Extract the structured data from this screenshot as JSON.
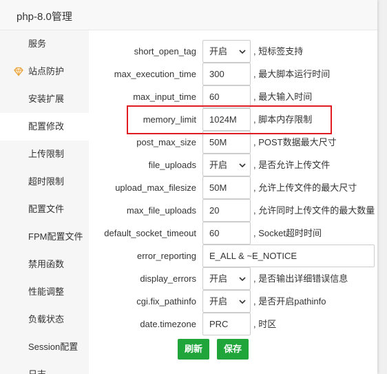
{
  "window": {
    "title": "php-8.0管理"
  },
  "sidebar": {
    "items": [
      {
        "label": "服务"
      },
      {
        "label": "站点防护"
      },
      {
        "label": "安装扩展"
      },
      {
        "label": "配置修改"
      },
      {
        "label": "上传限制"
      },
      {
        "label": "超时限制"
      },
      {
        "label": "配置文件"
      },
      {
        "label": "FPM配置文件"
      },
      {
        "label": "禁用函数"
      },
      {
        "label": "性能调整"
      },
      {
        "label": "负载状态"
      },
      {
        "label": "Session配置"
      },
      {
        "label": "日志"
      }
    ],
    "active": "配置修改"
  },
  "config": {
    "rows": [
      {
        "key": "short_open_tag",
        "value": "开启",
        "type": "select",
        "desc": ", 短标签支持"
      },
      {
        "key": "max_execution_time",
        "value": "300",
        "type": "input",
        "desc": ", 最大脚本运行时间"
      },
      {
        "key": "max_input_time",
        "value": "60",
        "type": "input",
        "desc": ", 最大输入时间"
      },
      {
        "key": "memory_limit",
        "value": "1024M",
        "type": "input",
        "desc": ", 脚本内存限制"
      },
      {
        "key": "post_max_size",
        "value": "50M",
        "type": "input",
        "desc": ", POST数据最大尺寸"
      },
      {
        "key": "file_uploads",
        "value": "开启",
        "type": "select",
        "desc": ", 是否允许上传文件"
      },
      {
        "key": "upload_max_filesize",
        "value": "50M",
        "type": "input",
        "desc": ", 允许上传文件的最大尺寸"
      },
      {
        "key": "max_file_uploads",
        "value": "20",
        "type": "input",
        "desc": ", 允许同时上传文件的最大数量"
      },
      {
        "key": "default_socket_timeout",
        "value": "60",
        "type": "input",
        "desc": ", Socket超时时间"
      },
      {
        "key": "error_reporting",
        "value": "E_ALL & ~E_NOTICE",
        "type": "wide",
        "desc": ""
      },
      {
        "key": "display_errors",
        "value": "开启",
        "type": "select",
        "desc": ", 是否输出详细错误信息"
      },
      {
        "key": "cgi.fix_pathinfo",
        "value": "开启",
        "type": "select",
        "desc": ", 是否开启pathinfo"
      },
      {
        "key": "date.timezone",
        "value": "PRC",
        "type": "input",
        "desc": ", 时区"
      }
    ]
  },
  "buttons": {
    "refresh": "刷新",
    "save": "保存"
  },
  "colors": {
    "accent": "#20a53a",
    "highlight": "#e11b22",
    "shield": "#e8a13a"
  }
}
